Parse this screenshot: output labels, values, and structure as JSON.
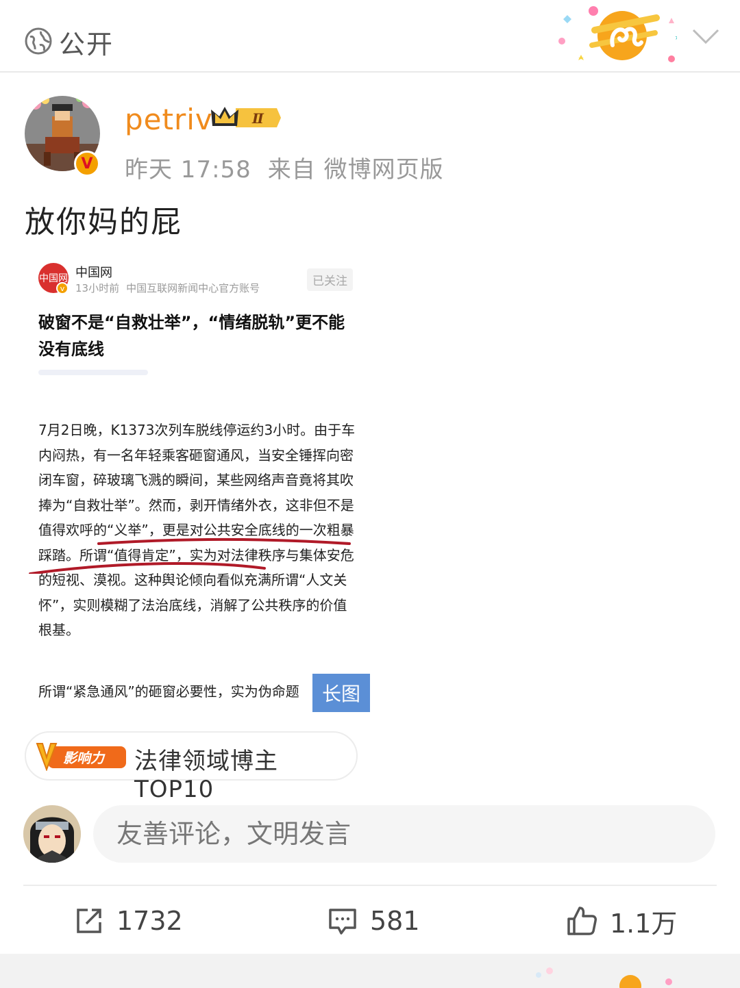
{
  "header": {
    "visibility_label": "公开"
  },
  "author": {
    "name": "petriv",
    "level_badge": "Ⅱ",
    "time": "昨天 17:58",
    "source": "来自 微博网页版",
    "verified_mark": "V"
  },
  "post": {
    "text": "放你妈的屁"
  },
  "shared_card": {
    "source_logo_text": "中国网",
    "source_name": "中国网",
    "source_time": "13小时前",
    "source_desc": "中国互联网新闻中心官方账号",
    "follow_label": "已关注",
    "headline": "破窗不是“自救壮举”，“情绪脱轨”更不能没有底线",
    "paragraph1": "7月2日晚，K1373次列车脱线停运约3小时。由于车内闷热，有一名年轻乘客砸窗通风，当安全锤挥向密闭车窗，碎玻璃飞溅的瞬间，某些网络声音竟将其吹捧为“自救壮举”。然而，剥开情绪外衣，这非但不是值得欢呼的“义举”，更是对公共安全底线的一次粗暴踩踏。所谓“值得肯定”，实为对法律秩序与集体安危的短视、漠视。这种舆论倾向看似充满所谓“人文关怀”，实则模糊了法治底线，消解了公共秩序的价值根基。",
    "paragraph2": "所谓“紧急通风”的砸窗必要性，实为伪命题",
    "long_image_label": "长图"
  },
  "influence": {
    "badge_text": "影响力",
    "label": "法律领域博主TOP10"
  },
  "comment": {
    "placeholder": "友善评论，文明发言"
  },
  "actions": {
    "repost_count": "1732",
    "comment_count": "581",
    "like_count": "1.1万"
  },
  "colors": {
    "username": "#f08b1d",
    "accent_orange": "#f4a000",
    "long_image_bg": "#5b8fd6",
    "ink_underline": "#b01a28"
  }
}
